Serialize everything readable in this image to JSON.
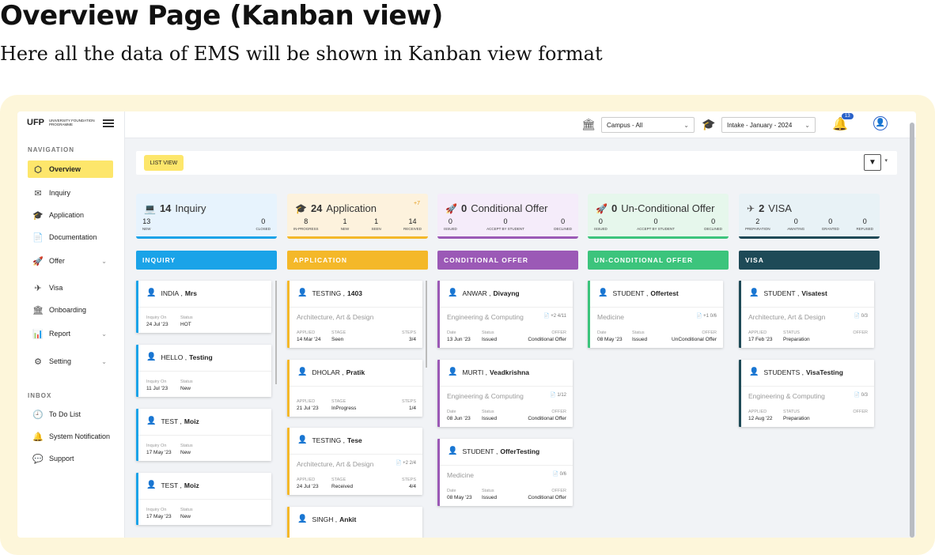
{
  "heading": "Overview Page (Kanban view)",
  "subheading": "Here all the data of EMS will be shown in Kanban view format",
  "logo": {
    "text": "UFP",
    "sub": "UNIVERSITY FOUNDATION PROGRAMME"
  },
  "nav_section": "NAVIGATION",
  "nav": [
    {
      "label": "Overview",
      "icon": "cube-icon"
    },
    {
      "label": "Inquiry",
      "icon": "mail-icon"
    },
    {
      "label": "Application",
      "icon": "graduation-cap-icon"
    },
    {
      "label": "Documentation",
      "icon": "document-icon"
    },
    {
      "label": "Offer",
      "icon": "rocket-icon"
    },
    {
      "label": "Visa",
      "icon": "plane-icon"
    },
    {
      "label": "Onboarding",
      "icon": "bank-icon"
    },
    {
      "label": "Report",
      "icon": "bar-chart-icon"
    },
    {
      "label": "Setting",
      "icon": "gear-icon"
    }
  ],
  "inbox_section": "INBOX",
  "inbox": [
    {
      "label": "To Do List",
      "icon": "clock-icon"
    },
    {
      "label": "System Notification",
      "icon": "bell-icon"
    },
    {
      "label": "Support",
      "icon": "chat-icon"
    }
  ],
  "top": {
    "campus": "Campus - All",
    "intake": "Intake - January - 2024",
    "notif_count": "13"
  },
  "list_view": "LIST VIEW",
  "columns": [
    {
      "count": "14",
      "title": "Inquiry",
      "color": "#1aa3e8",
      "bg": "#e7f3fd",
      "header": "INQUIRY",
      "plus": "",
      "metrics": [
        {
          "v": "13",
          "l": "NEW"
        },
        {
          "v": "0",
          "l": "CLOSED"
        }
      ],
      "cards": [
        {
          "type": "INDIA",
          "name": "Mrs",
          "k1": "Inquiry On",
          "v1": "24 Jul '23",
          "k2": "Status",
          "v2": "HOT"
        },
        {
          "type": "HELLO",
          "name": "Testing",
          "k1": "Inquiry On",
          "v1": "11 Jul '23",
          "k2": "Status",
          "v2": "New"
        },
        {
          "type": "TEST",
          "name": "Moiz",
          "k1": "Inquiry On",
          "v1": "17 May '23",
          "k2": "Status",
          "v2": "New"
        },
        {
          "type": "TEST",
          "name": "Moiz",
          "k1": "Inquiry On",
          "v1": "17 May '23",
          "k2": "Status",
          "v2": "New"
        }
      ]
    },
    {
      "count": "24",
      "title": "Application",
      "color": "#f4b829",
      "bg": "#fdf2dd",
      "header": "APPLICATION",
      "plus": "+7",
      "metrics": [
        {
          "v": "8",
          "l": "IN-PROGRESS"
        },
        {
          "v": "1",
          "l": "NEW"
        },
        {
          "v": "1",
          "l": "SEEN"
        },
        {
          "v": "14",
          "l": "RECEIVED"
        }
      ],
      "cards": [
        {
          "type": "TESTING",
          "name": "1403",
          "sub": "Architecture, Art & Design",
          "k1": "APPLIED",
          "v1": "14 Mar '24",
          "k2": "STAGE",
          "v2": "Seen",
          "k3": "STEPS",
          "v3": "3/4"
        },
        {
          "type": "DHOLAR",
          "name": "Pratik",
          "k1": "APPLIED",
          "v1": "21 Jul '23",
          "k2": "STAGE",
          "v2": "InProgress",
          "k3": "STEPS",
          "v3": "1/4"
        },
        {
          "type": "TESTING",
          "name": "Tese",
          "sub": "Architecture, Art & Design",
          "sr": "+2 2/4",
          "k1": "APPLIED",
          "v1": "24 Jul '23",
          "k2": "STAGE",
          "v2": "Received",
          "k3": "STEPS",
          "v3": "4/4"
        },
        {
          "type": "SINGH",
          "name": "Ankit"
        }
      ]
    },
    {
      "count": "0",
      "title": "Conditional Offer",
      "color": "#9b59b6",
      "bg": "#f5ecfa",
      "header": "CONDITIONAL OFFER",
      "plus": "",
      "metrics": [
        {
          "v": "0",
          "l": "ISSUED"
        },
        {
          "v": "0",
          "l": "ACCEPT BY STUDENT"
        },
        {
          "v": "0",
          "l": "DECLINED"
        }
      ],
      "cards": [
        {
          "type": "ANWAR",
          "name": "Divayng",
          "sub": "Engineering & Computing",
          "sr": "+2 4/11",
          "k1": "Date",
          "v1": "13 Jun '23",
          "k2": "Status",
          "v2": "Issued",
          "k3": "OFFER",
          "v3": "Conditional Offer"
        },
        {
          "type": "MURTI",
          "name": "Veadkrishna",
          "sub": "Engineering & Computing",
          "sr": "1/12",
          "k1": "Date",
          "v1": "08 Jun '23",
          "k2": "Status",
          "v2": "Issued",
          "k3": "OFFER",
          "v3": "Conditional Offer"
        },
        {
          "type": "STUDENT",
          "name": "OfferTesting",
          "sub": "Medicine",
          "sr": "0/6",
          "k1": "Date",
          "v1": "08 May '23",
          "k2": "Status",
          "v2": "Issued",
          "k3": "OFFER",
          "v3": "Conditional Offer"
        }
      ]
    },
    {
      "count": "0",
      "title": "Un-Conditional Offer",
      "color": "#3cc47c",
      "bg": "#e6f7ec",
      "header": "UN-CONDITIONAL OFFER",
      "plus": "",
      "metrics": [
        {
          "v": "0",
          "l": "ISSUED"
        },
        {
          "v": "0",
          "l": "ACCEPT BY STUDENT"
        },
        {
          "v": "0",
          "l": "DECLINED"
        }
      ],
      "cards": [
        {
          "type": "STUDENT",
          "name": "Offertest",
          "sub": "Medicine",
          "sr": "+1 0/6",
          "k1": "Date",
          "v1": "08 May '23",
          "k2": "Status",
          "v2": "Issued",
          "k3": "OFFER",
          "v3": "UnConditional Offer"
        }
      ]
    },
    {
      "count": "2",
      "title": "VISA",
      "color": "#1e4a57",
      "bg": "#e8f2f6",
      "header": "VISA",
      "plus": "",
      "metrics": [
        {
          "v": "2",
          "l": "PREPARATION"
        },
        {
          "v": "0",
          "l": "AWAITING"
        },
        {
          "v": "0",
          "l": "GRANTED"
        },
        {
          "v": "0",
          "l": "REFUSED"
        }
      ],
      "cards": [
        {
          "type": "STUDENT",
          "name": "Visatest",
          "sub": "Architecture, Art & Design",
          "sr": "0/3",
          "k1": "APPLIED",
          "v1": "17 Feb '23",
          "k2": "STATUS",
          "v2": "Preparation",
          "k3": "OFFER",
          "v3": ""
        },
        {
          "type": "STUDENTS",
          "name": "VisaTesting",
          "sub": "Engineering & Computing",
          "sr": "0/3",
          "k1": "APPLIED",
          "v1": "12 Aug '22",
          "k2": "STATUS",
          "v2": "Preparation",
          "k3": "OFFER",
          "v3": ""
        }
      ]
    }
  ]
}
